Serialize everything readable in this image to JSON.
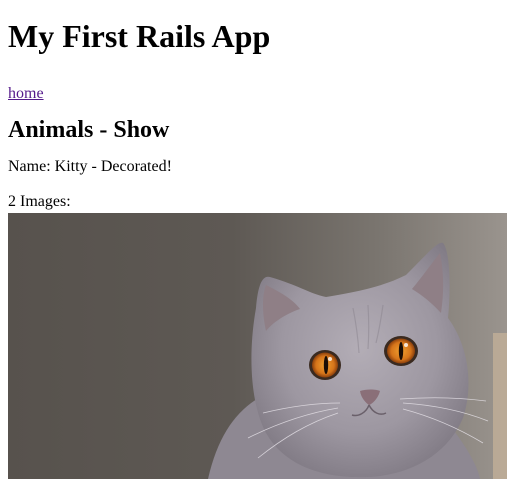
{
  "header": {
    "app_title": "My First Rails App"
  },
  "nav": {
    "home_label": "home"
  },
  "main": {
    "heading": "Animals - Show",
    "name_line": "Name: Kitty - Decorated!",
    "images_line": "2 Images:"
  },
  "image": {
    "subject": "grey cat with orange eyes",
    "background_color": "#5c5752",
    "fur_color": "#9e98a0",
    "eye_color": "#d97a1c"
  }
}
